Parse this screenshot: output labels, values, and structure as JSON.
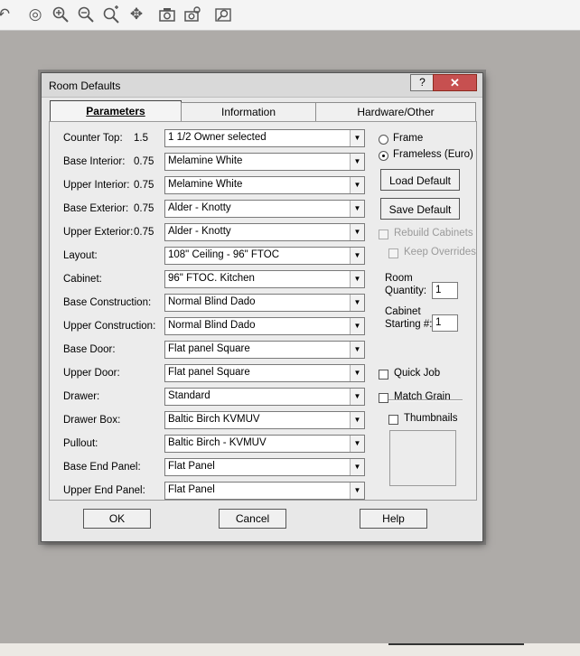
{
  "toolbar": {
    "icons": [
      "undo-icon",
      "target-icon",
      "zoom-in-icon",
      "zoom-out-icon",
      "zoom-extents-icon",
      "pan-icon",
      "camera-icon",
      "camera-settings-icon",
      "zoom-window-icon"
    ]
  },
  "dialog": {
    "title": "Room Defaults",
    "help_label": "?",
    "close_label": "✕"
  },
  "tabs": [
    "Parameters",
    "Information",
    "Hardware/Other"
  ],
  "params": {
    "counter_top": {
      "label": "Counter Top:",
      "value": "1.5",
      "selected": "1 1/2 Owner selected"
    },
    "base_interior": {
      "label": "Base Interior:",
      "value": "0.75",
      "selected": "Melamine White"
    },
    "upper_interior": {
      "label": "Upper Interior:",
      "value": "0.75",
      "selected": "Melamine White"
    },
    "base_exterior": {
      "label": "Base Exterior:",
      "value": "0.75",
      "selected": "Alder - Knotty"
    },
    "upper_exterior": {
      "label": "Upper Exterior:",
      "value": "0.75",
      "selected": "Alder - Knotty"
    },
    "layout": {
      "label": "Layout:",
      "selected": "108\" Ceiling - 96\" FTOC"
    },
    "cabinet": {
      "label": "Cabinet:",
      "selected": "96\" FTOC. Kitchen"
    },
    "base_construction": {
      "label": "Base Construction:",
      "selected": "Normal Blind Dado"
    },
    "upper_construction": {
      "label": "Upper Construction:",
      "selected": "Normal Blind Dado"
    },
    "base_door": {
      "label": "Base Door:",
      "selected": "Flat panel Square"
    },
    "upper_door": {
      "label": "Upper Door:",
      "selected": "Flat panel Square"
    },
    "drawer": {
      "label": "Drawer:",
      "selected": "Standard"
    },
    "drawer_box": {
      "label": "Drawer Box:",
      "selected": "Baltic Birch KVMUV"
    },
    "pullout": {
      "label": "Pullout:",
      "selected": "Baltic Birch - KVMUV"
    },
    "base_end_panel": {
      "label": "Base End Panel:",
      "selected": "Flat Panel"
    },
    "upper_end_panel": {
      "label": "Upper End Panel:",
      "selected": "Flat Panel"
    }
  },
  "right": {
    "frame_label": "Frame",
    "frameless_label": "Frameless (Euro)",
    "load_default": "Load Default",
    "save_default": "Save Default",
    "rebuild_cabinets": "Rebuild Cabinets",
    "keep_overrides": "Keep Overrides",
    "room_quantity_label_1": "Room",
    "room_quantity_label_2": "Quantity:",
    "room_quantity_value": "1",
    "cabinet_start_label_1": "Cabinet",
    "cabinet_start_label_2": "Starting #:",
    "cabinet_start_value": "1",
    "quick_job": "Quick Job",
    "match_grain": "Match Grain",
    "thumbnails": "Thumbnails"
  },
  "footer": {
    "ok": "OK",
    "cancel": "Cancel",
    "help": "Help"
  }
}
